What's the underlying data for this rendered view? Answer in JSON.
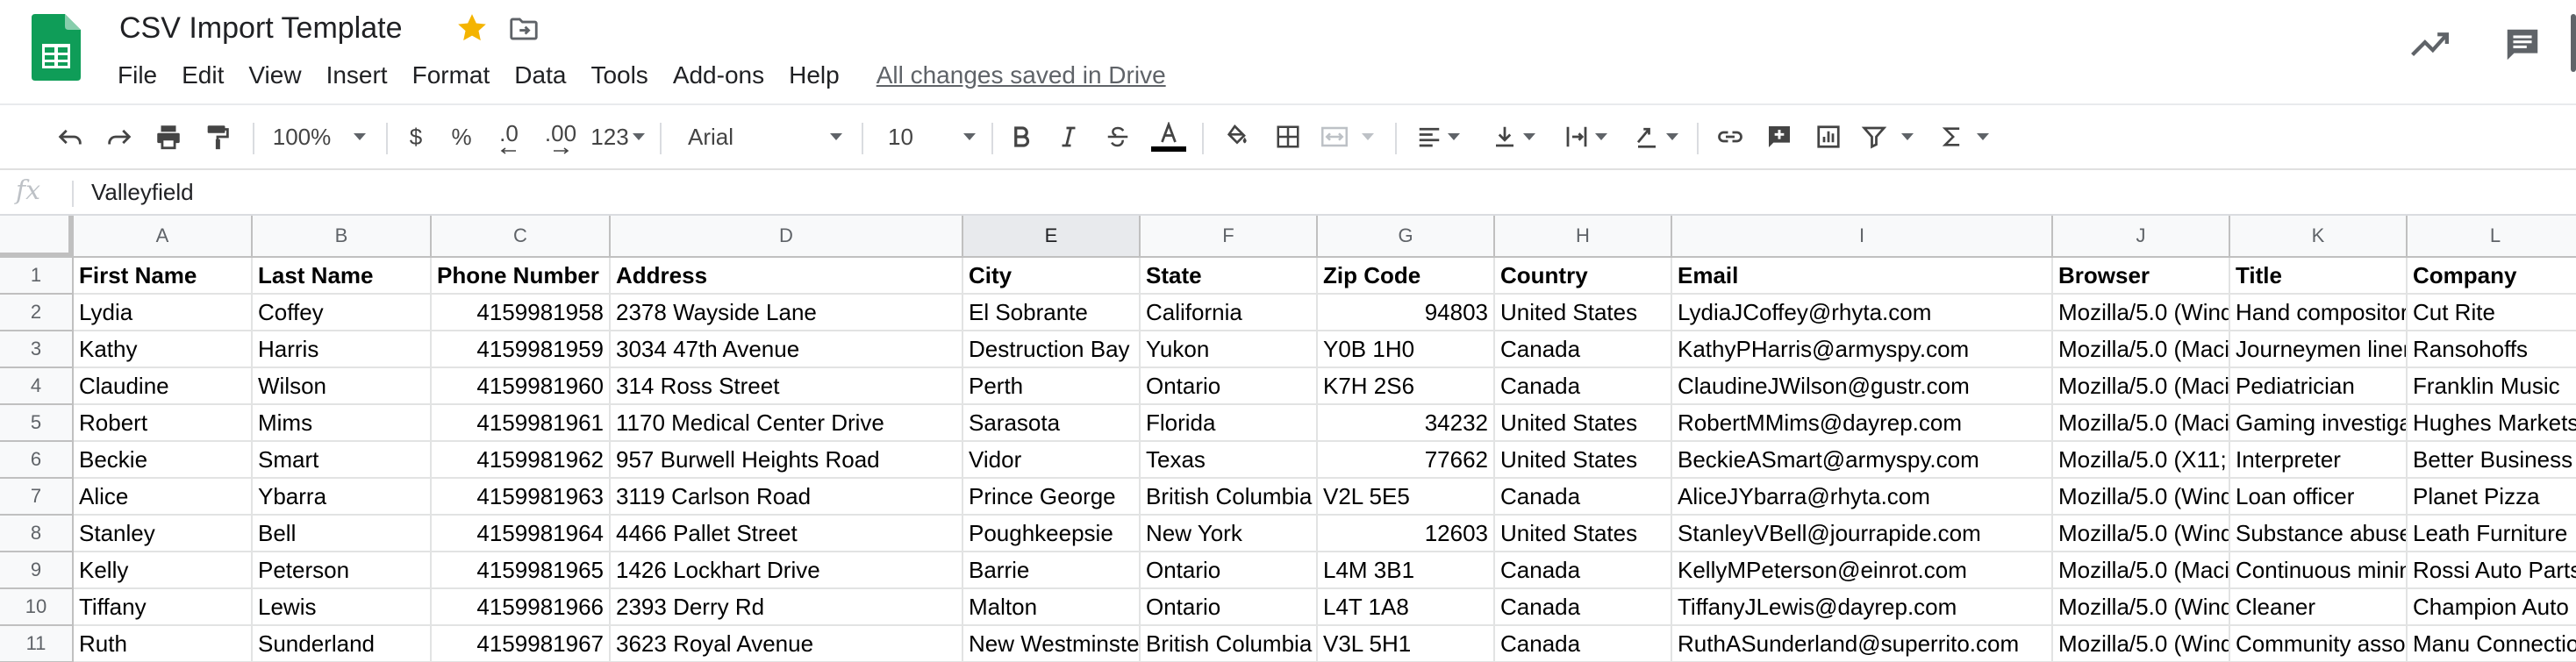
{
  "doc": {
    "title": "CSV Import Template",
    "save_status": "All changes saved in Drive"
  },
  "menu": [
    "File",
    "Edit",
    "View",
    "Insert",
    "Format",
    "Data",
    "Tools",
    "Add-ons",
    "Help"
  ],
  "toolbar": {
    "zoom": "100%",
    "currency": "$",
    "percent": "%",
    "decrease_decimals": ".0",
    "increase_decimals": ".00",
    "more_formats": "123",
    "font": "Arial",
    "font_size": "10"
  },
  "formula_bar": {
    "fx_label": "fx",
    "value": "Valleyfield"
  },
  "colors": {
    "sheets_green": "#0f9d58",
    "star_yellow": "#f4b400"
  },
  "sheet": {
    "columns": [
      "A",
      "B",
      "C",
      "D",
      "E",
      "F",
      "G",
      "H",
      "I",
      "J",
      "K",
      "L"
    ],
    "selected_column": "E",
    "rows": [
      {
        "num": "1",
        "cells": [
          "First Name",
          "Last Name",
          "Phone Number",
          "Address",
          "City",
          "State",
          "Zip Code",
          "Country",
          "Email",
          "Browser",
          "Title",
          "Company"
        ]
      },
      {
        "num": "2",
        "cells": [
          "Lydia",
          "Coffey",
          "4159981958",
          "2378 Wayside Lane",
          "El Sobrante",
          "California",
          "94803",
          "United States",
          "LydiaJCoffey@rhyta.com",
          "Mozilla/5.0 (Wind",
          "Hand compositor",
          "Cut Rite"
        ]
      },
      {
        "num": "3",
        "cells": [
          "Kathy",
          "Harris",
          "4159981959",
          "3034 47th Avenue",
          "Destruction Bay",
          "Yukon",
          "Y0B 1H0",
          "Canada",
          "KathyPHarris@armyspy.com",
          "Mozilla/5.0 (Maci",
          "Journeymen liner",
          "Ransohoffs"
        ]
      },
      {
        "num": "4",
        "cells": [
          "Claudine",
          "Wilson",
          "4159981960",
          "314 Ross Street",
          "Perth",
          "Ontario",
          "K7H 2S6",
          "Canada",
          "ClaudineJWilson@gustr.com",
          "Mozilla/5.0 (Maci",
          "Pediatrician",
          "Franklin Music"
        ]
      },
      {
        "num": "5",
        "cells": [
          "Robert",
          "Mims",
          "4159981961",
          "1170 Medical Center Drive",
          "Sarasota",
          "Florida",
          "34232",
          "United States",
          "RobertMMims@dayrep.com",
          "Mozilla/5.0 (Maci",
          "Gaming investiga",
          "Hughes Markets"
        ]
      },
      {
        "num": "6",
        "cells": [
          "Beckie",
          "Smart",
          "4159981962",
          "957 Burwell Heights Road",
          "Vidor",
          "Texas",
          "77662",
          "United States",
          "BeckieASmart@armyspy.com",
          "Mozilla/5.0 (X11;",
          "Interpreter",
          "Better Business"
        ]
      },
      {
        "num": "7",
        "cells": [
          "Alice",
          "Ybarra",
          "4159981963",
          "3119 Carlson Road",
          "Prince George",
          "British Columbia",
          "V2L 5E5",
          "Canada",
          "AliceJYbarra@rhyta.com",
          "Mozilla/5.0 (Wind",
          "Loan officer",
          "Planet Pizza"
        ]
      },
      {
        "num": "8",
        "cells": [
          "Stanley",
          "Bell",
          "4159981964",
          "4466 Pallet Street",
          "Poughkeepsie",
          "New York",
          "12603",
          "United States",
          "StanleyVBell@jourrapide.com",
          "Mozilla/5.0 (Wind",
          "Substance abuse",
          "Leath Furniture"
        ]
      },
      {
        "num": "9",
        "cells": [
          "Kelly",
          "Peterson",
          "4159981965",
          "1426 Lockhart Drive",
          "Barrie",
          "Ontario",
          "L4M 3B1",
          "Canada",
          "KellyMPeterson@einrot.com",
          "Mozilla/5.0 (Maci",
          "Continuous minin",
          "Rossi Auto Parts"
        ]
      },
      {
        "num": "10",
        "cells": [
          "Tiffany",
          "Lewis",
          "4159981966",
          "2393 Derry Rd",
          "Malton",
          "Ontario",
          "L4T 1A8",
          "Canada",
          "TiffanyJLewis@dayrep.com",
          "Mozilla/5.0 (Wind",
          "Cleaner",
          "Champion Auto"
        ]
      },
      {
        "num": "11",
        "cells": [
          "Ruth",
          "Sunderland",
          "4159981967",
          "3623 Royal Avenue",
          "New Westminste",
          "British Columbia",
          "V3L 5H1",
          "Canada",
          "RuthASunderland@superrito.com",
          "Mozilla/5.0 (Wind",
          "Community asso",
          "Manu Connection"
        ]
      }
    ]
  }
}
